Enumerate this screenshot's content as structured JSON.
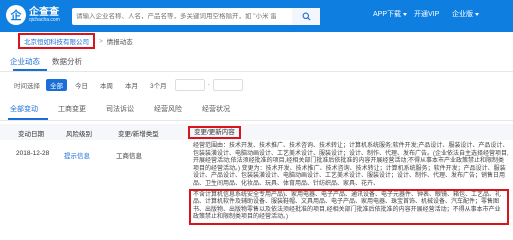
{
  "header": {
    "logo_mark": "企",
    "logo_name": "企查查",
    "logo_domain": "qichacha.com",
    "search_placeholder": "请输入企业名称、人名，产品名等，多关键词用空格隔开，如 \"小米 雷军\"",
    "nav_app": "APP下载",
    "nav_vip": "开通VIP",
    "nav_enterprise": "企业版"
  },
  "breadcrumb": {
    "company": "北京恒如科技有限公司",
    "separator": ">",
    "current": "情报动态"
  },
  "tabs_primary": [
    "企业动态",
    "数据分析"
  ],
  "time_filter": {
    "label": "时间选择",
    "options": [
      "全部",
      "今日",
      "本周",
      "本月",
      "3个月"
    ],
    "date_separator": "-"
  },
  "tabs_secondary": [
    "全部变动",
    "工商变更",
    "司法诉讼",
    "经营风险",
    "经营状况"
  ],
  "table": {
    "headers": {
      "date": "变动日期",
      "risk": "风险级别",
      "type": "变更/新增类型",
      "content": "变更/更新内容"
    },
    "row": {
      "date": "2018-12-28",
      "risk": "提示信息",
      "type": "工商信息",
      "content_old": "经营范围由：技术开发、技术推广、技术咨询、技术转让；计算机系统服务;软件开发;产品设计、服装设计、产品设计、包装装潢设计、电脑动画设计、工艺美术设计、服装设计；设计、制作、代理、发布广告。(企业依法自主选择经营项目,开展经营活动;依法须经批准的项目,经相关部门批准后依批准的内容开展经营活动;不得从事本市产业政策禁止和限制类项目的经营活动。) 变更为：技术开发、技术推广、技术咨询、技术转让；计算机系统服务；软件开发；产品设计、服装设计、产品设计、包装装潢设计、电脑动画设计、工艺美术设计、服装设计；设计、制作、代理、发布广告；销售日用品、卫生间用品、化妆品、玩具、体育用品、针纺织品、家具、花卉、",
      "content_new": "不含计算机信息系统安全专用产品)、家用电器、电子产品、通讯设备、电子元器件、钟表、眼镜、箱包、工艺品、礼品、计算机软件及辅助设备、服装鞋帽、文具用品、电子产品、家用电器、珠宝首饰、机械设备、汽车配件；零售图书、出版物、出版物零售以及依法须经批准的项目,经相关部门批准后依批准的内容开展经营活动；不得从事本市产业政策禁止和限制类项目的经营活动。)"
    }
  },
  "colors": {
    "brand": "#0e7fe0",
    "link": "#1a6fd6",
    "highlight_box": "#d8141c"
  }
}
